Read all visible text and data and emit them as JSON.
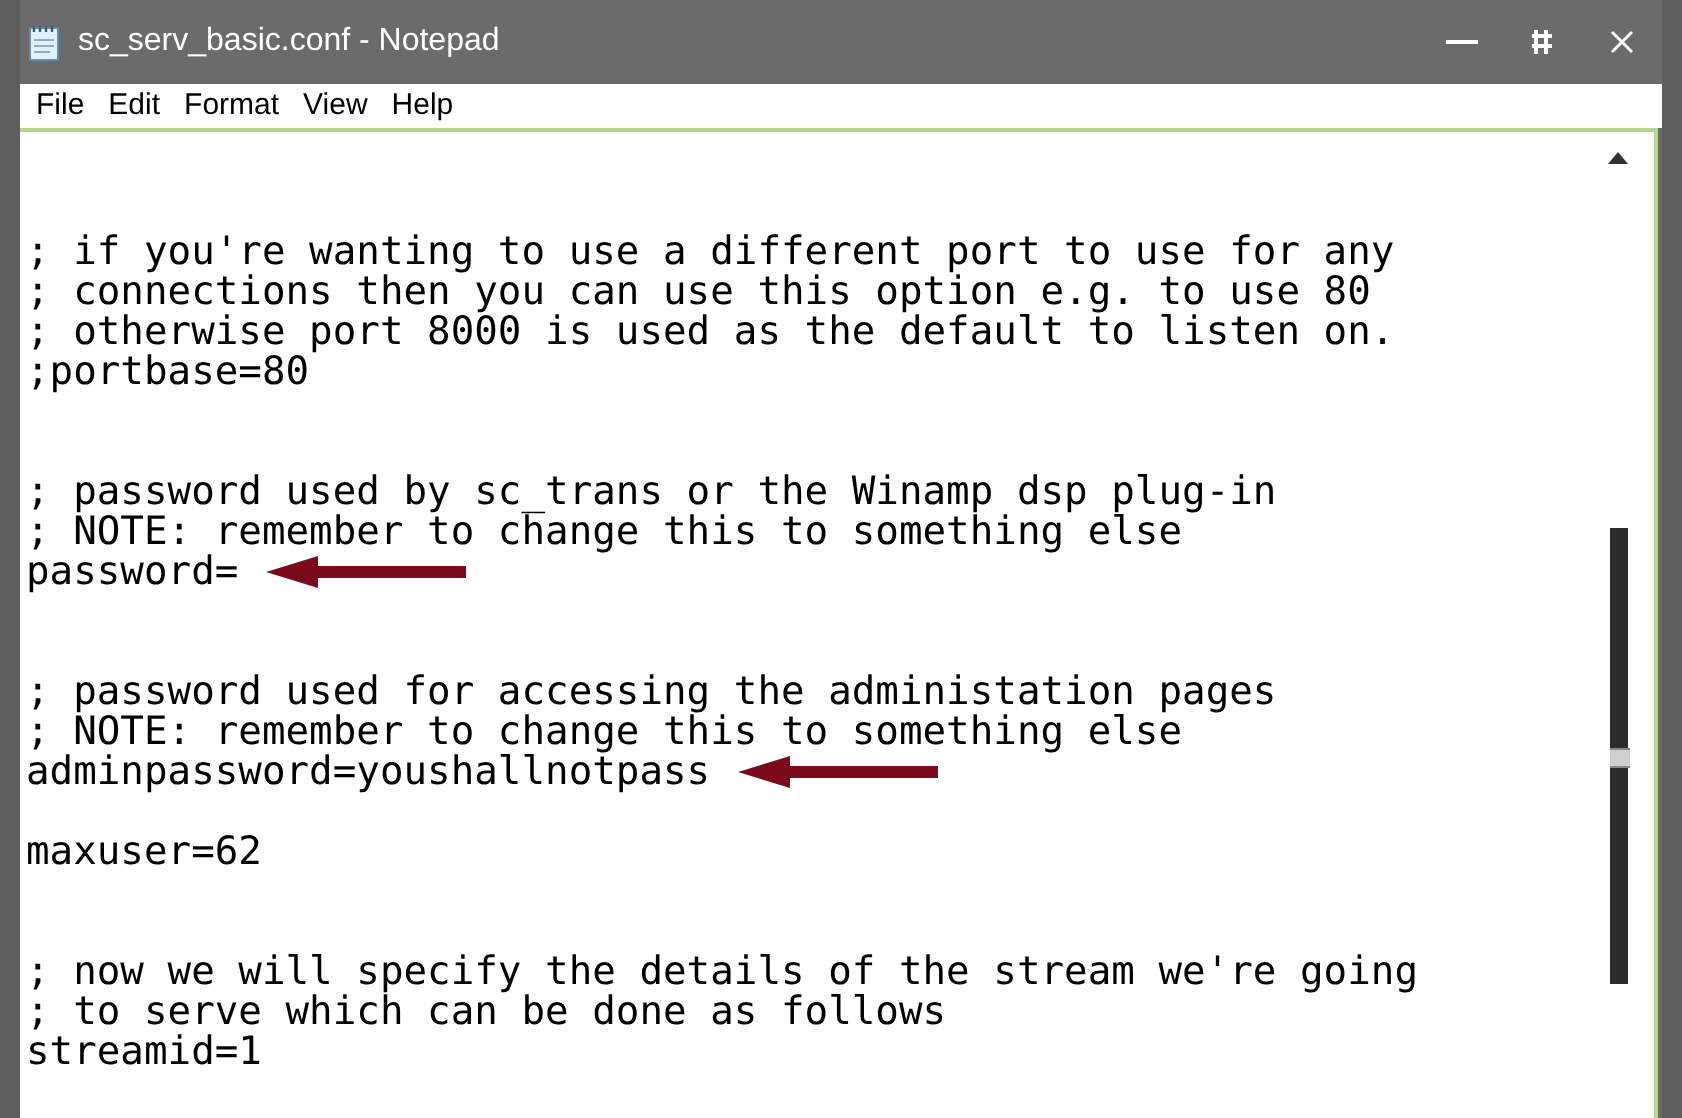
{
  "window": {
    "title": "sc_serv_basic.conf - Notepad"
  },
  "menu": [
    "File",
    "Edit",
    "Format",
    "View",
    "Help"
  ],
  "lines": [
    {
      "kind": "blank"
    },
    {
      "kind": "text",
      "text": "; if you're wanting to use a different port to use for any",
      "arrow": false
    },
    {
      "kind": "text",
      "text": "; connections then you can use this option e.g. to use 80",
      "arrow": false
    },
    {
      "kind": "text",
      "text": "; otherwise port 8000 is used as the default to listen on.",
      "arrow": false
    },
    {
      "kind": "text",
      "text": ";portbase=80",
      "arrow": false
    },
    {
      "kind": "blank"
    },
    {
      "kind": "blank"
    },
    {
      "kind": "text",
      "text": "; password used by sc_trans or the Winamp dsp plug-in",
      "arrow": false
    },
    {
      "kind": "text",
      "text": "; NOTE: remember to change this to something else",
      "arrow": false
    },
    {
      "kind": "text",
      "text": "password=",
      "arrow": true
    },
    {
      "kind": "blank"
    },
    {
      "kind": "blank"
    },
    {
      "kind": "text",
      "text": "; password used for accessing the administation pages",
      "arrow": false
    },
    {
      "kind": "text",
      "text": "; NOTE: remember to change this to something else",
      "arrow": false
    },
    {
      "kind": "text",
      "text": "adminpassword=youshallnotpass",
      "arrow": true
    },
    {
      "kind": "blank"
    },
    {
      "kind": "text",
      "text": "maxuser=62",
      "arrow": false
    },
    {
      "kind": "blank"
    },
    {
      "kind": "blank"
    },
    {
      "kind": "text",
      "text": "; now we will specify the details of the stream we're going",
      "arrow": false
    },
    {
      "kind": "text",
      "text": "; to serve which can be done as follows",
      "arrow": false
    },
    {
      "kind": "text",
      "text": "streamid=1",
      "arrow": false
    }
  ]
}
